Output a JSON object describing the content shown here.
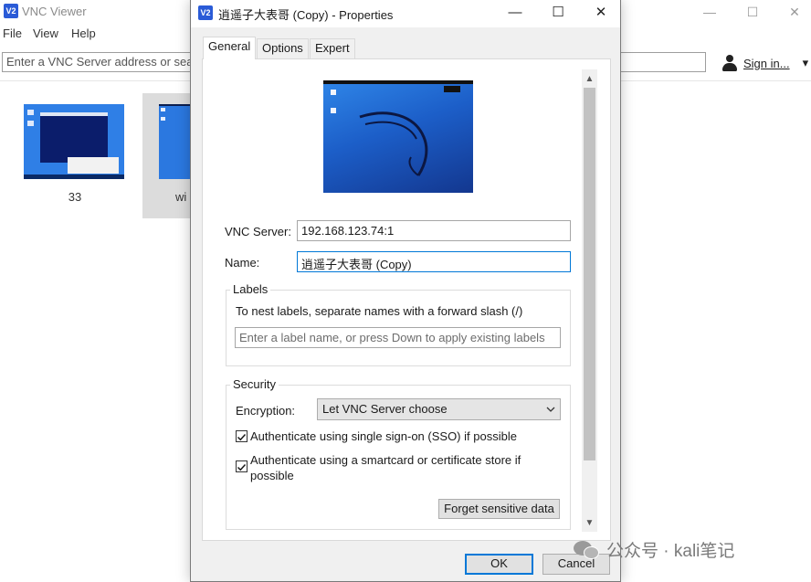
{
  "viewer": {
    "title": "VNC Viewer",
    "icon": "vnc-logo",
    "window_controls": [
      "—",
      "☐",
      "✕"
    ],
    "menu": [
      "File",
      "View",
      "Help"
    ],
    "search_placeholder": "Enter a VNC Server address or sea",
    "signin_label": "Sign in...",
    "signin_arrow": "▾",
    "connections": [
      {
        "label": "33",
        "selected": false
      },
      {
        "label": "wi",
        "selected": true
      }
    ]
  },
  "dialog": {
    "title": "逍遥子大表哥 (Copy) - Properties",
    "icon": "vnc-logo",
    "window_controls": [
      "—",
      "☐",
      "✕"
    ],
    "tabs": [
      {
        "label": "General",
        "active": true
      },
      {
        "label": "Options",
        "active": false
      },
      {
        "label": "Expert",
        "active": false
      }
    ],
    "vnc_server_label": "VNC Server:",
    "vnc_server_value": "192.168.123.74:1",
    "name_label": "Name:",
    "name_value": "逍遥子大表哥 (Copy)",
    "labels_group": {
      "title": "Labels",
      "hint": "To nest labels, separate names with a forward slash (/)",
      "placeholder": "Enter a label name, or press Down to apply existing labels"
    },
    "security_group": {
      "title": "Security",
      "encryption_label": "Encryption:",
      "encryption_value": "Let VNC Server choose",
      "checkboxes": [
        {
          "label": "Authenticate using single sign-on (SSO) if possible",
          "checked": true
        },
        {
          "label": "Authenticate using a smartcard or certificate store if possible",
          "checked": true
        }
      ],
      "forget_button": "Forget sensitive data"
    },
    "ok_label": "OK",
    "cancel_label": "Cancel",
    "scroll_up": "▲",
    "scroll_down": "▼"
  },
  "watermark": {
    "text": "公众号 · kali笔记",
    "icon": "wechat-icon"
  },
  "colors": {
    "accent": "#0078d7",
    "desktop_blue": "#1c5ec8"
  }
}
